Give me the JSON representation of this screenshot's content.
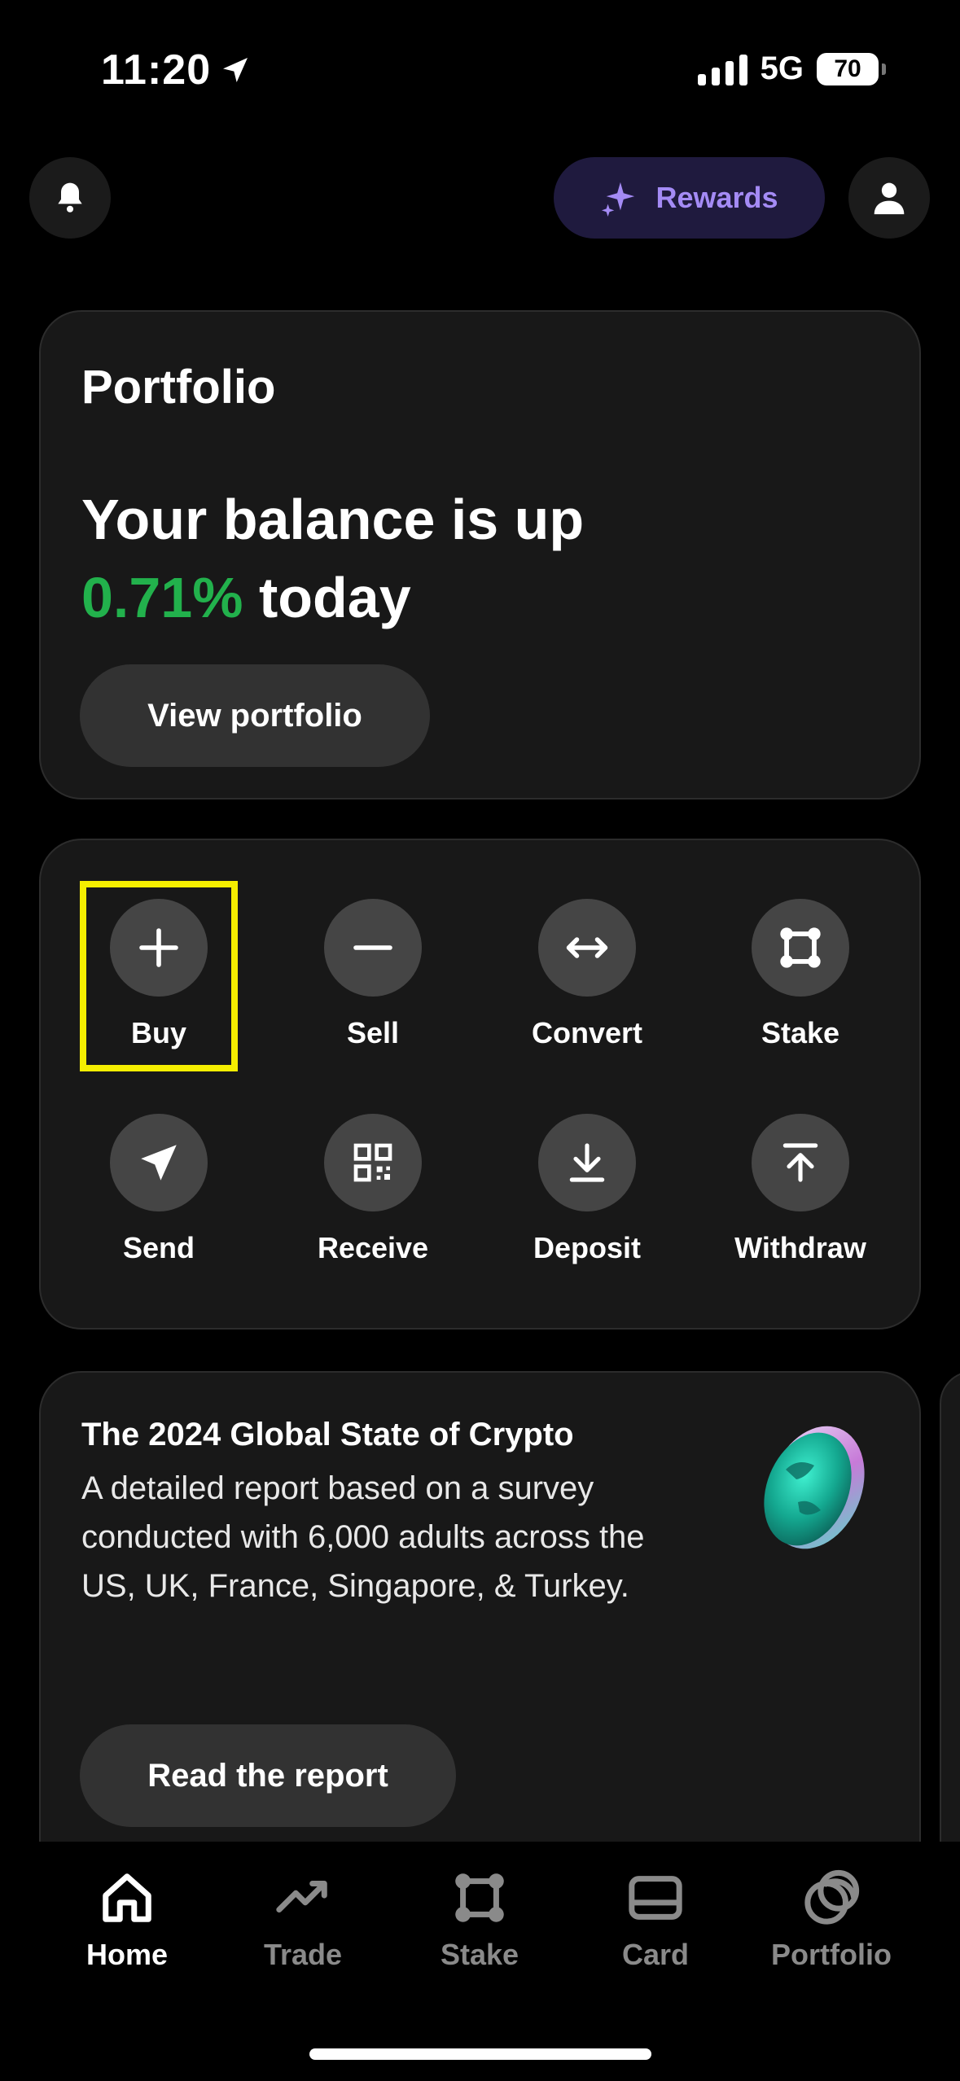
{
  "status_bar": {
    "time": "11:20",
    "network": "5G",
    "battery": "70"
  },
  "header": {
    "rewards_label": "Rewards"
  },
  "portfolio_card": {
    "title": "Portfolio",
    "headline_prefix": "Your balance is up",
    "change_percent": "0.71%",
    "headline_suffix": "today",
    "button_label": "View portfolio"
  },
  "actions": [
    {
      "label": "Buy",
      "icon": "plus-icon"
    },
    {
      "label": "Sell",
      "icon": "minus-icon"
    },
    {
      "label": "Convert",
      "icon": "arrows-horizontal-icon"
    },
    {
      "label": "Stake",
      "icon": "stake-nodes-icon"
    },
    {
      "label": "Send",
      "icon": "send-arrow-icon"
    },
    {
      "label": "Receive",
      "icon": "qr-code-icon"
    },
    {
      "label": "Deposit",
      "icon": "download-icon"
    },
    {
      "label": "Withdraw",
      "icon": "upload-icon"
    }
  ],
  "report_card": {
    "title": "The 2024 Global State of Crypto",
    "body": "A detailed report based on a survey conducted with 6,000 adults across the US, UK, France, Singapore, & Turkey.",
    "button_label": "Read the report"
  },
  "tabs": [
    {
      "label": "Home",
      "icon": "home-icon",
      "active": true
    },
    {
      "label": "Trade",
      "icon": "trend-icon",
      "active": false
    },
    {
      "label": "Stake",
      "icon": "stake-nodes-icon",
      "active": false
    },
    {
      "label": "Card",
      "icon": "card-icon",
      "active": false
    },
    {
      "label": "Portfolio",
      "icon": "coins-icon",
      "active": false
    }
  ],
  "colors": {
    "accent_green": "#22b14c",
    "rewards_purple": "#a48bf5",
    "highlight_yellow": "#f5ee00"
  }
}
